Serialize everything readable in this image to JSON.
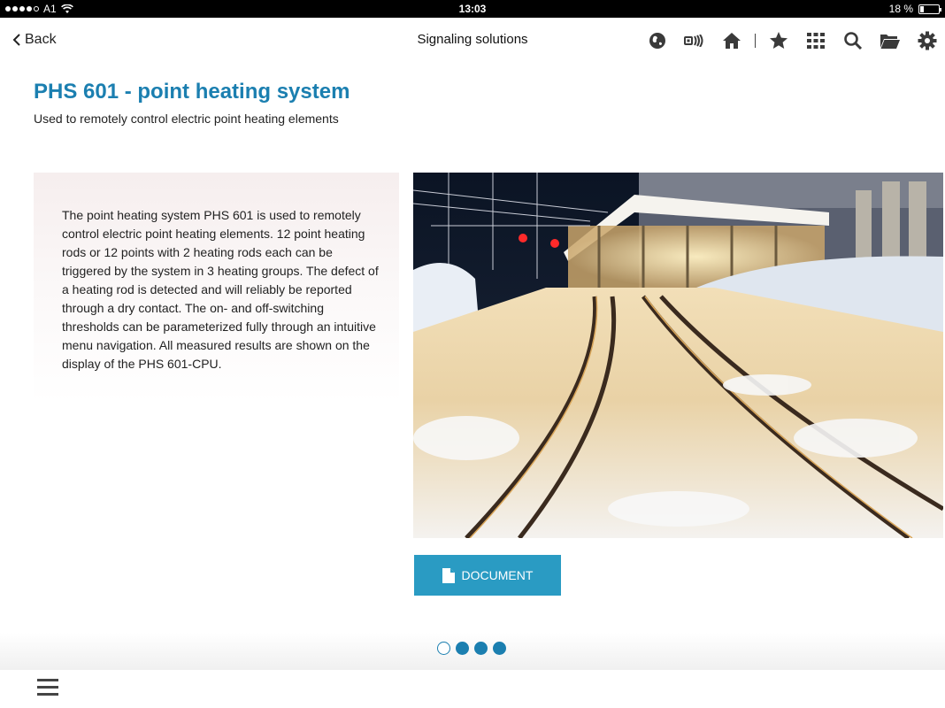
{
  "status_bar": {
    "carrier": "A1",
    "time": "13:03",
    "battery": "18 %",
    "battery_level": 0.18
  },
  "nav": {
    "back_label": "Back",
    "title": "Signaling solutions",
    "icons": [
      "globe-icon",
      "signal-icon",
      "home-icon",
      "star-icon",
      "grid-icon",
      "search-icon",
      "folder-icon",
      "gear-icon"
    ]
  },
  "content": {
    "title": "PHS 601 - point heating system",
    "subtitle": "Used to remotely control electric point heating elements",
    "description": "The point heating system PHS 601 is used to remotely control electric point heating elements. 12 point heating rods or 12 points with 2 heating rods each can be triggered by the system in 3 heating groups. The defect of a heating rod is detected and will reliably be reported through a dry contact. The on- and off-switching thresholds can be parameterized fully through an intuitive menu navigation. All measured results are shown on the display of the PHS 601-CPU.",
    "document_button": "DOCUMENT"
  },
  "pager": {
    "total": 4,
    "current": 1
  },
  "colors": {
    "accent": "#1b7fb0",
    "button": "#2a9bc3"
  }
}
